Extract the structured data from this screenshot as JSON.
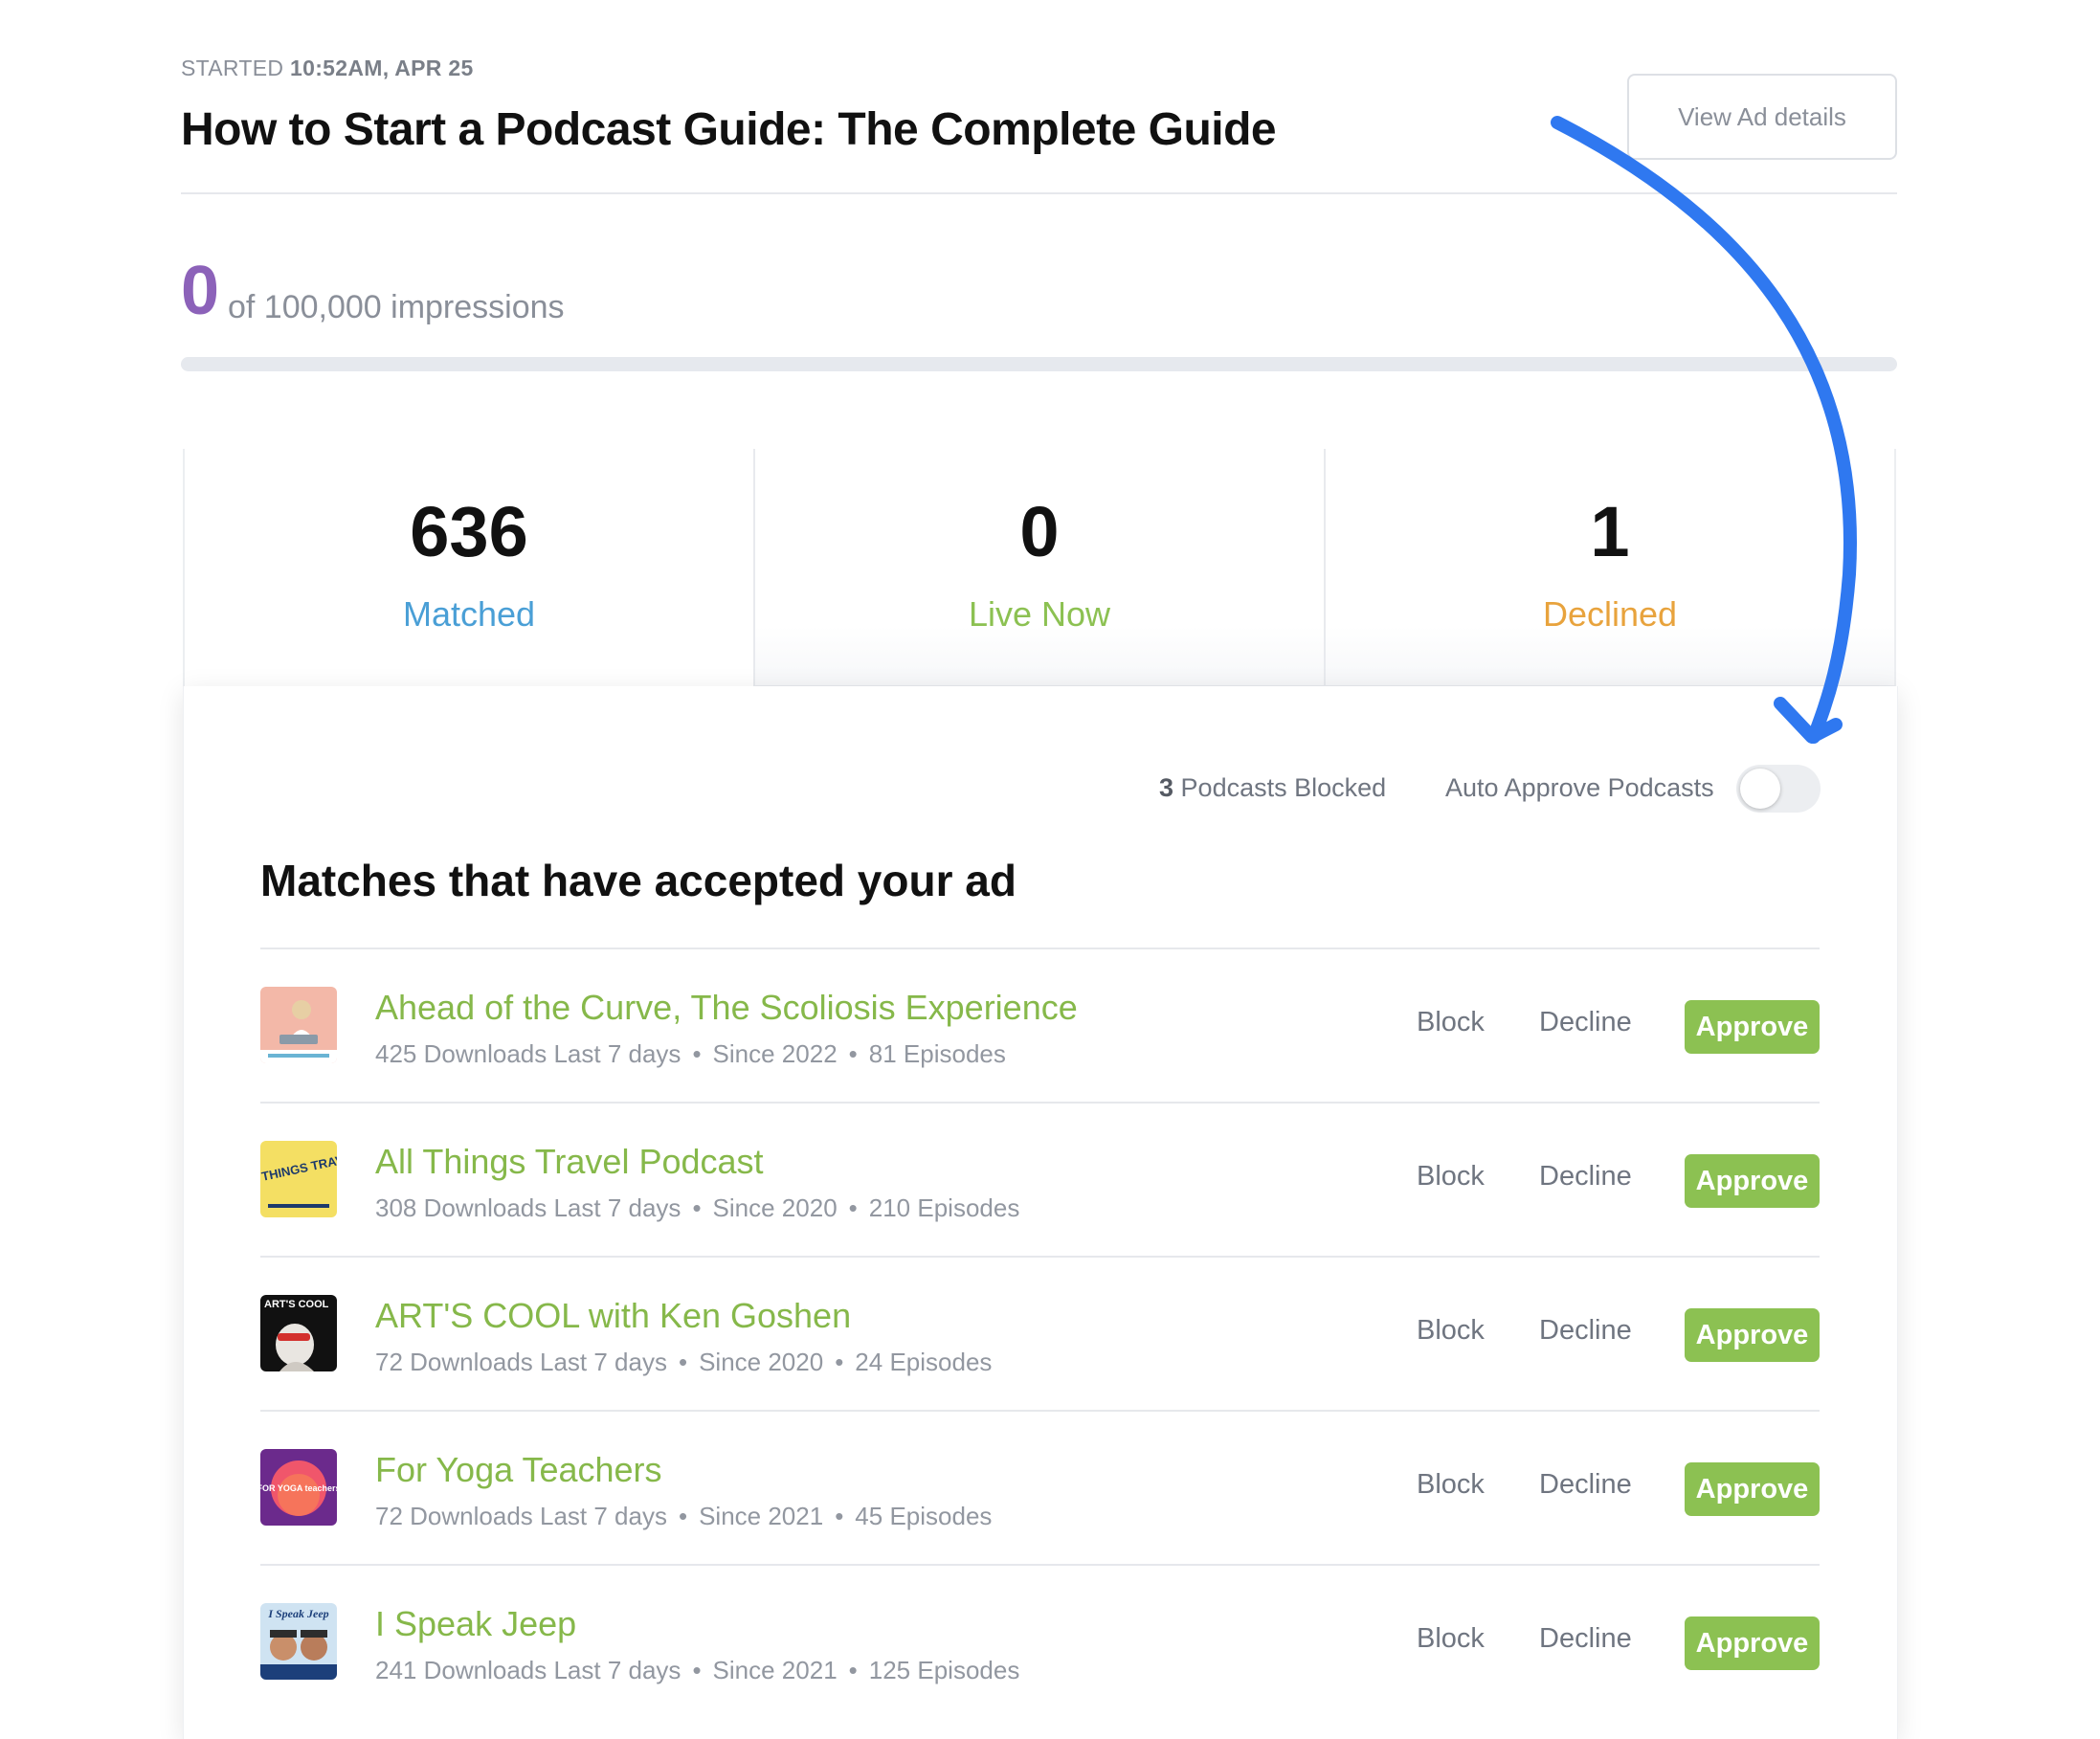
{
  "header": {
    "started_label": "STARTED",
    "started_value": "10:52AM, APR 25",
    "title": "How to Start a Podcast Guide: The Complete Guide",
    "view_button": "View Ad details"
  },
  "impressions": {
    "current": "0",
    "of_text": "of 100,000 impressions",
    "progress": 0
  },
  "stats": [
    {
      "value": "636",
      "label": "Matched",
      "color": "#4a9fd6"
    },
    {
      "value": "0",
      "label": "Live Now",
      "color": "#8cc152"
    },
    {
      "value": "1",
      "label": "Declined",
      "color": "#e8a33d"
    }
  ],
  "controls": {
    "blocked_count": "3",
    "blocked_text": "Podcasts Blocked",
    "auto_approve_label": "Auto Approve Podcasts",
    "auto_approve_on": false
  },
  "section": {
    "title": "Matches that have accepted your ad"
  },
  "actions": {
    "block": "Block",
    "decline": "Decline",
    "approve": "Approve"
  },
  "podcasts": [
    {
      "name": "Ahead of the Curve, The Scoliosis Experience",
      "downloads": "425 Downloads Last 7 days",
      "since": "Since 2022",
      "episodes": "81 Episodes",
      "thumb_icon": "scoliosis-cover-art"
    },
    {
      "name": "All Things Travel Podcast",
      "downloads": "308 Downloads Last 7 days",
      "since": "Since 2020",
      "episodes": "210 Episodes",
      "thumb_icon": "travel-cover-art",
      "thumb_text": "ALL THINGS TRAVEL"
    },
    {
      "name": "ART'S COOL with Ken Goshen",
      "downloads": "72 Downloads Last 7 days",
      "since": "Since 2020",
      "episodes": "24 Episodes",
      "thumb_icon": "arts-cool-cover-art",
      "thumb_text": "ART'S COOL"
    },
    {
      "name": "For Yoga Teachers",
      "downloads": "72 Downloads Last 7 days",
      "since": "Since 2021",
      "episodes": "45 Episodes",
      "thumb_icon": "yoga-cover-art",
      "thumb_text": "FOR YOGA teachers"
    },
    {
      "name": "I Speak Jeep",
      "downloads": "241 Downloads Last 7 days",
      "since": "Since 2021",
      "episodes": "125 Episodes",
      "thumb_icon": "jeep-cover-art",
      "thumb_text": "I Speak Jeep"
    }
  ],
  "colors": {
    "accent_purple": "#8c62b9",
    "approve_green": "#8cc152",
    "arrow_blue": "#2f78f0"
  }
}
